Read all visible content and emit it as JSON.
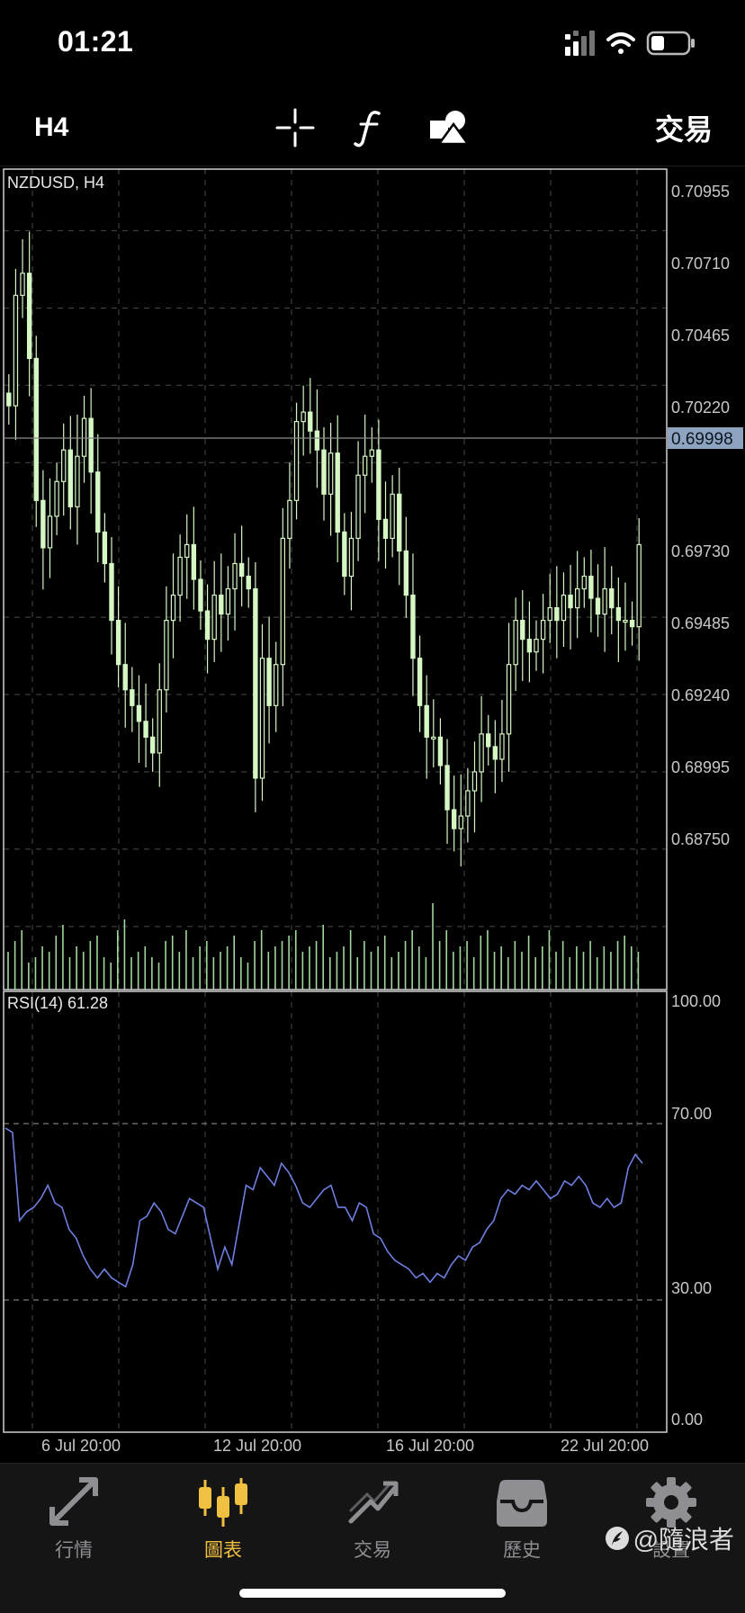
{
  "status_bar": {
    "time": "01:21"
  },
  "toolbar": {
    "timeframe": "H4",
    "trade_label": "交易",
    "icons": [
      "crosshair-icon",
      "indicators-icon",
      "objects-icon"
    ]
  },
  "chart": {
    "symbol_label": "NZDUSD, H4",
    "price_labels": [
      "0.70955",
      "0.70710",
      "0.70465",
      "0.70220",
      "0.69730",
      "0.69485",
      "0.69240",
      "0.68995",
      "0.68750"
    ],
    "current_price": "0.69998",
    "indicator_label": "RSI(14) 61.28",
    "rsi_labels": [
      "100.00",
      "70.00",
      "30.00",
      "0.00"
    ],
    "time_labels": [
      "6 Jul 20:00",
      "12 Jul 20:00",
      "16 Jul 20:00",
      "22 Jul 20:00"
    ],
    "colors": {
      "candle": "#d4f7c4",
      "volume": "#9fd89a",
      "rsi": "#6f7fe0",
      "grid": "#4a4a4a",
      "axis_text": "#c8c8c8"
    }
  },
  "chart_data": {
    "type": "candlestick",
    "symbol": "NZDUSD",
    "timeframe": "H4",
    "price_ylim": [
      0.6855,
      0.7115
    ],
    "rsi_ylim": [
      0,
      100
    ],
    "rsi_levels": [
      70,
      30
    ],
    "current_price": 0.69998,
    "closes": [
      0.704,
      0.7075,
      0.7082,
      0.7055,
      0.701,
      0.6995,
      0.7005,
      0.7016,
      0.7026,
      0.7008,
      0.7024,
      0.7036,
      0.7019,
      0.7,
      0.699,
      0.6972,
      0.6958,
      0.695,
      0.6945,
      0.694,
      0.6935,
      0.693,
      0.695,
      0.6972,
      0.698,
      0.6992,
      0.6996,
      0.6985,
      0.6975,
      0.6966,
      0.698,
      0.6974,
      0.6982,
      0.699,
      0.6986,
      0.6982,
      0.6922,
      0.696,
      0.6945,
      0.6958,
      0.6998,
      0.701,
      0.7035,
      0.7038,
      0.7032,
      0.7026,
      0.7012,
      0.7025,
      0.7,
      0.6986,
      0.6998,
      0.7018,
      0.7024,
      0.7026,
      0.7004,
      0.6998,
      0.7012,
      0.6994,
      0.698,
      0.696,
      0.6945,
      0.6935,
      0.6935,
      0.6926,
      0.6912,
      0.6906,
      0.691,
      0.6918,
      0.6924,
      0.6936,
      0.6932,
      0.6928,
      0.6936,
      0.6958,
      0.6972,
      0.6966,
      0.6962,
      0.6966,
      0.6972,
      0.6976,
      0.6972,
      0.698,
      0.6976,
      0.6982,
      0.6986,
      0.6979,
      0.6974,
      0.6982,
      0.6976,
      0.6972,
      0.6972,
      0.697,
      0.6996
    ],
    "volume_norm": [
      0.35,
      0.45,
      0.55,
      0.25,
      0.3,
      0.4,
      0.35,
      0.5,
      0.6,
      0.3,
      0.4,
      0.35,
      0.45,
      0.5,
      0.3,
      0.25,
      0.55,
      0.65,
      0.3,
      0.35,
      0.4,
      0.3,
      0.25,
      0.45,
      0.5,
      0.35,
      0.55,
      0.3,
      0.4,
      0.45,
      0.3,
      0.35,
      0.4,
      0.5,
      0.3,
      0.25,
      0.45,
      0.55,
      0.35,
      0.4,
      0.45,
      0.5,
      0.55,
      0.35,
      0.4,
      0.45,
      0.6,
      0.3,
      0.35,
      0.4,
      0.55,
      0.3,
      0.45,
      0.35,
      0.4,
      0.5,
      0.3,
      0.35,
      0.45,
      0.55,
      0.4,
      0.3,
      0.8,
      0.45,
      0.55,
      0.35,
      0.4,
      0.45,
      0.3,
      0.5,
      0.55,
      0.35,
      0.4,
      0.3,
      0.45,
      0.35,
      0.5,
      0.3,
      0.4,
      0.55,
      0.35,
      0.45,
      0.3,
      0.4,
      0.35,
      0.45,
      0.3,
      0.4,
      0.35,
      0.45,
      0.5,
      0.4,
      0.35
    ],
    "rsi": [
      69,
      68,
      48,
      50,
      51,
      53,
      56,
      52,
      51,
      46,
      44,
      40,
      37,
      35,
      37,
      35,
      34,
      33,
      38,
      48,
      49,
      52,
      50,
      46,
      45,
      49,
      53,
      52,
      51,
      44,
      37,
      42,
      38,
      47,
      56,
      55,
      60,
      58,
      56,
      61,
      59,
      56,
      52,
      51,
      53,
      55,
      56,
      51,
      51,
      48,
      52,
      51,
      45,
      44,
      41,
      39,
      38,
      37,
      35,
      36,
      34,
      36,
      35,
      38,
      40,
      39,
      42,
      43,
      46,
      48,
      53,
      55,
      54,
      56,
      55,
      57,
      55,
      53,
      54,
      57,
      56,
      58,
      56,
      52,
      51,
      53,
      51,
      52,
      60,
      63,
      61
    ]
  },
  "bottom_nav": {
    "items": [
      {
        "label": "行情",
        "icon": "quotes-arrows-icon",
        "active": false
      },
      {
        "label": "圖表",
        "icon": "candlestick-chart-icon",
        "active": true
      },
      {
        "label": "交易",
        "icon": "trade-trend-icon",
        "active": false
      },
      {
        "label": "歷史",
        "icon": "history-inbox-icon",
        "active": false
      },
      {
        "label": "設置",
        "icon": "settings-gear-icon",
        "active": false
      }
    ]
  },
  "watermark": {
    "text": "@隨浪者"
  }
}
